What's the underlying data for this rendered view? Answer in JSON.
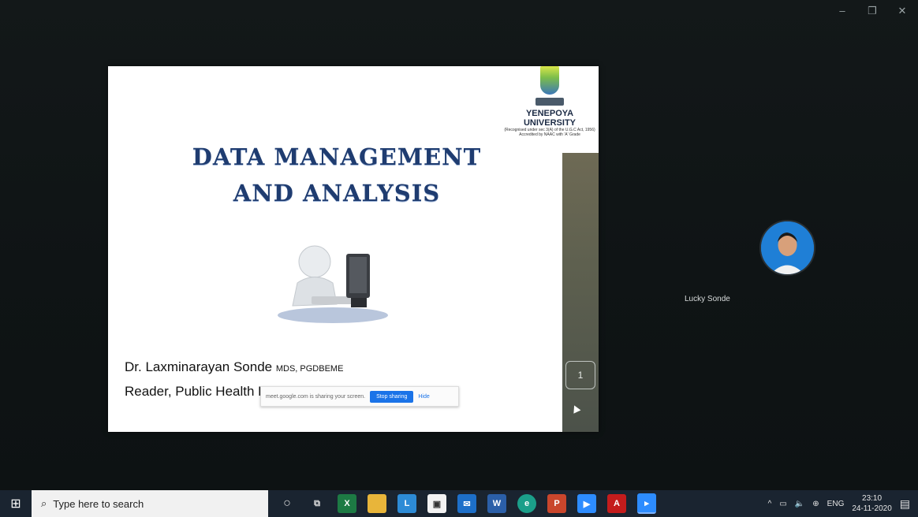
{
  "window": {
    "minimize_icon": "–",
    "maximize_icon": "❐",
    "close_icon": "✕"
  },
  "slide": {
    "logo_name_line1": "YENEPOYA",
    "logo_name_line2": "UNIVERSITY",
    "logo_sub": "(Recognised under sec 3(A) of the U.G.C Act, 1956) Accredited by NAAC with 'A' Grade",
    "title_line1": "DATA MANAGEMENT",
    "title_line2": "AND ANALYSIS",
    "author_name": "Dr. Laxminarayan Sonde",
    "author_quals": "MDS, PGDBEME",
    "author_role": "Reader, Public Health Dentistry",
    "page_number": "1"
  },
  "share_bar": {
    "message": "meet.google.com is sharing your screen.",
    "stop_label": "Stop sharing",
    "hide_label": "Hide"
  },
  "participant": {
    "name": "Lucky Sonde"
  },
  "taskbar": {
    "search_placeholder": "Type here to search",
    "icons": [
      "cortana-icon",
      "task-view-icon",
      "excel-icon",
      "file-explorer-icon",
      "l-app-icon",
      "store-icon",
      "mail-icon",
      "word-icon",
      "edge-icon",
      "powerpoint-icon",
      "zoom-icon",
      "acrobat-icon",
      "media-player-icon"
    ],
    "tray_lang": "ENG",
    "time": "23:10",
    "date": "24-11-2020"
  },
  "colors": {
    "accent": "#1a73e8",
    "title": "#1f3c70",
    "taskbar": "#1a2430"
  }
}
